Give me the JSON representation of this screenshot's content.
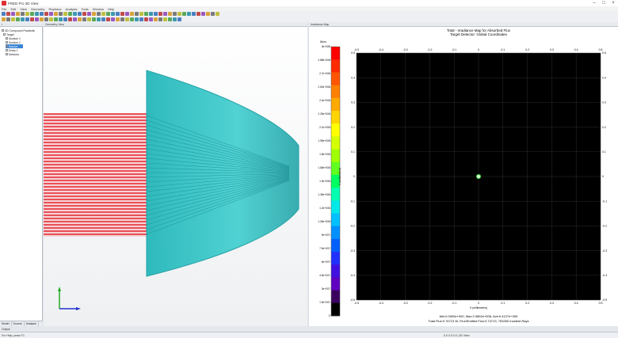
{
  "app": {
    "title": "FRED Pro 3D View",
    "accent": "#3a86d4"
  },
  "menu": [
    "File",
    "Edit",
    "View",
    "Geometry",
    "Raytrace",
    "Analysis",
    "Tools",
    "Window",
    "Help"
  ],
  "tree": {
    "items": [
      {
        "label": "3D Compound Parabolic",
        "level": 0
      },
      {
        "label": "Target",
        "level": 1
      },
      {
        "label": "Surface 1",
        "level": 2
      },
      {
        "label": "Surface 2",
        "level": 2
      },
      {
        "label": "Source",
        "level": 2,
        "selected": true
      },
      {
        "label": "Entity 1",
        "level": 2
      },
      {
        "label": "Detector",
        "level": 2
      }
    ],
    "tabs": [
      "Model",
      "Source",
      "Analysis"
    ]
  },
  "view3d": {
    "header": "Geometry View",
    "beam_color": "#e8333c",
    "reflector_color": "#2bbfc0"
  },
  "analysis": {
    "header": "Irradiance Map",
    "title": "Total - Irradiance Map for Absorbed Flux",
    "subtitle": "Target Detector: Global Coordinates",
    "unit_label": "W/m²",
    "xlabel": "X (millimeters)",
    "ylabel": "Y (millimeters)",
    "stats_line1": "Min:0.0000e+000, Max:2.9892e+008, Ave:9.4127e+005",
    "stats_line2": "Total Flux:0.74713 W, Flux/Emitted Flux:0.74713, 753260 Incident Rays"
  },
  "colorbar": {
    "labels": [
      "3e+008",
      "2.88e+008",
      "2.7e+008",
      "2.52e+008",
      "2.4e+008",
      "2.25e+008",
      "2.1e+008",
      "1.95e+008",
      "1.8e+008",
      "1.65e+008",
      "1.5e+008",
      "1.35e+008",
      "1.2e+008",
      "1.05e+008",
      "9e+007",
      "7.5e+007",
      "6e+007",
      "4.5e+007",
      "3e+007",
      "1.5e+007",
      "0"
    ],
    "colors": [
      "#ff0000",
      "#ff2a00",
      "#ff5500",
      "#ff8000",
      "#ffaa00",
      "#ffd400",
      "#ffff00",
      "#d4ff00",
      "#a0ff00",
      "#60ff20",
      "#00ff60",
      "#00ffb0",
      "#00e8e8",
      "#00c0ff",
      "#0090ff",
      "#0060ff",
      "#2030ff",
      "#4010e0",
      "#6000c0",
      "#3a0060",
      "#000000"
    ]
  },
  "chart_data": {
    "type": "heatmap",
    "title": "Total - Irradiance Map for Absorbed Flux",
    "subtitle": "Target Detector: Global Coordinates",
    "xlabel": "X (millimeters)",
    "ylabel": "Y (millimeters)",
    "xlim": [
      -0.5,
      0.5
    ],
    "ylim": [
      -0.5,
      0.5
    ],
    "x_ticks": [
      "-0.5",
      "-0.4",
      "-0.3",
      "-0.2",
      "-0.1",
      "0",
      "0.1",
      "0.2",
      "0.3",
      "0.4",
      "0.5"
    ],
    "y_ticks": [
      "0.5",
      "0.4",
      "0.3",
      "0.2",
      "0.1",
      "0",
      "-0.1",
      "-0.2",
      "-0.3",
      "-0.4",
      "-0.5"
    ],
    "spot": {
      "x": 0,
      "y": 0
    },
    "grid": true
  },
  "status": {
    "left": "For Help, press F1",
    "right": "0.0 0.0 0.0  | 3D View"
  },
  "bottom_tabs": "Output"
}
